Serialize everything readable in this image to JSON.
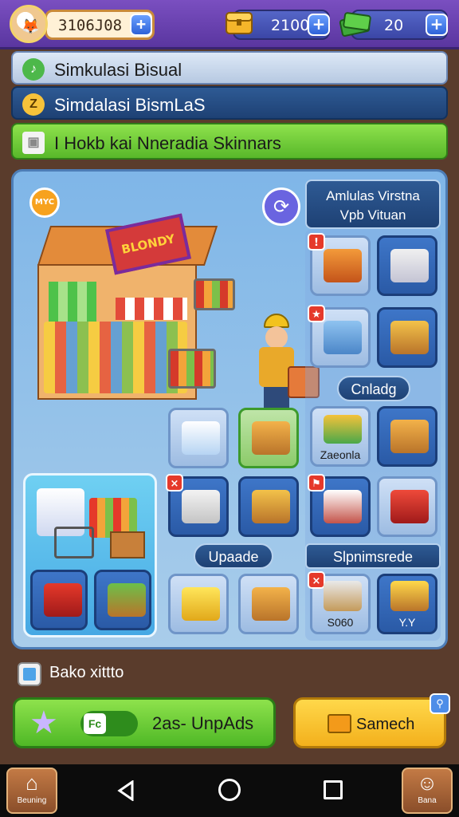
{
  "topbar": {
    "coins": "3106J08",
    "gold": "2100",
    "gems": "20",
    "plus": "+"
  },
  "banners": [
    {
      "text": "Simkulasi Bisual",
      "icon": "♪"
    },
    {
      "text": "Simdalasi BismLaS",
      "icon": "Z"
    },
    {
      "text": "I Hokb kai Nneradia Skinnars",
      "icon": "▣"
    }
  ],
  "panel": {
    "coin_badge": "MYC",
    "shop_sign": "BLONDY",
    "info_card": [
      "Amlulas Virstna",
      "Vpb Vituan"
    ],
    "labels": {
      "cnladg": "Cnladg",
      "upade": "Upaade",
      "slpnims": "Slpnimsrede"
    },
    "tile_texts": {
      "zaeonla": "Zaeonla",
      "price": "S060",
      "hint": "Y.Y"
    }
  },
  "bottom": {
    "back_label": "Bako xittto",
    "green_button": "2as- UnpAds",
    "toggle_knob": "Fc",
    "yellow_button": "Samech",
    "corner_icon": "⚲"
  },
  "navbar": {
    "home_label": "Beuning",
    "bana_label": "Bana"
  },
  "colors": {
    "accent_purple": "#6a42b0",
    "green": "#58b82a",
    "yellow": "#f3b01c",
    "panel_blue": "#7fb6e8"
  }
}
